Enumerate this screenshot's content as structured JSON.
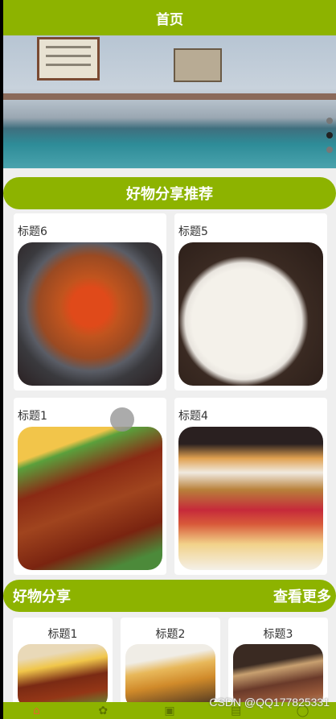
{
  "header": {
    "title": "首页"
  },
  "banner": {
    "slide_count": 3,
    "active_index": 1
  },
  "featured": {
    "title": "好物分享推荐",
    "cards": [
      {
        "title": "标题6",
        "image": "crab-noodle-dish"
      },
      {
        "title": "标题5",
        "image": "waffle-breakfast-plate"
      },
      {
        "title": "标题1",
        "image": "grilled-steak"
      },
      {
        "title": "标题4",
        "image": "fried-chicken-burger"
      }
    ]
  },
  "share": {
    "title": "好物分享",
    "more_label": "查看更多",
    "items": [
      {
        "title": "标题1",
        "image": "grilled-steak"
      },
      {
        "title": "标题2",
        "image": "soup-bowl"
      },
      {
        "title": "标题3",
        "image": "meat-platter"
      }
    ]
  },
  "tabbar": {
    "tabs": [
      {
        "icon": "home-icon",
        "active": true
      },
      {
        "icon": "category-icon",
        "active": false
      },
      {
        "icon": "cart-icon",
        "active": false
      },
      {
        "icon": "order-icon",
        "active": false
      },
      {
        "icon": "user-icon",
        "active": false
      }
    ]
  },
  "watermark": "CSDN @QQ177825331",
  "colors": {
    "brand": "#8db300",
    "text": "#333333",
    "background": "#efefef"
  }
}
